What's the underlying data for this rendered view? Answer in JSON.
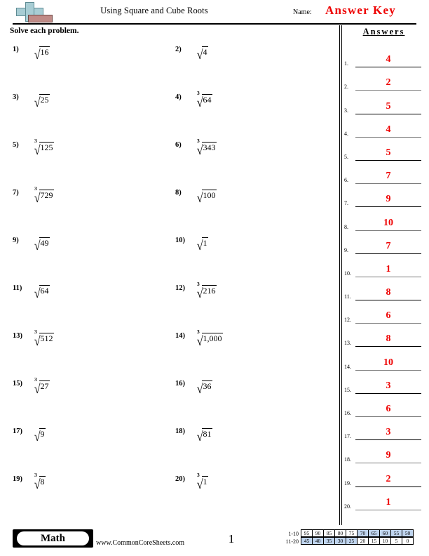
{
  "header": {
    "title": "Using Square and Cube Roots",
    "name_label": "Name:",
    "answer_key": "Answer Key",
    "logo_icon": "plus-block-logo"
  },
  "instruction": "Solve each problem.",
  "problems": [
    {
      "number": "1)",
      "index": "",
      "radicand": "16",
      "symbol": "√"
    },
    {
      "number": "2)",
      "index": "",
      "radicand": "4",
      "symbol": "√"
    },
    {
      "number": "3)",
      "index": "",
      "radicand": "25",
      "symbol": "√"
    },
    {
      "number": "4)",
      "index": "3",
      "radicand": "64",
      "symbol": "√"
    },
    {
      "number": "5)",
      "index": "3",
      "radicand": "125",
      "symbol": "√"
    },
    {
      "number": "6)",
      "index": "3",
      "radicand": "343",
      "symbol": "√"
    },
    {
      "number": "7)",
      "index": "3",
      "radicand": "729",
      "symbol": "√"
    },
    {
      "number": "8)",
      "index": "",
      "radicand": "100",
      "symbol": "√"
    },
    {
      "number": "9)",
      "index": "",
      "radicand": "49",
      "symbol": "√"
    },
    {
      "number": "10)",
      "index": "",
      "radicand": "1",
      "symbol": "√"
    },
    {
      "number": "11)",
      "index": "",
      "radicand": "64",
      "symbol": "√"
    },
    {
      "number": "12)",
      "index": "3",
      "radicand": "216",
      "symbol": "√"
    },
    {
      "number": "13)",
      "index": "3",
      "radicand": "512",
      "symbol": "√"
    },
    {
      "number": "14)",
      "index": "3",
      "radicand": "1,000",
      "symbol": "√"
    },
    {
      "number": "15)",
      "index": "3",
      "radicand": "27",
      "symbol": "√"
    },
    {
      "number": "16)",
      "index": "",
      "radicand": "36",
      "symbol": "√"
    },
    {
      "number": "17)",
      "index": "",
      "radicand": "9",
      "symbol": "√"
    },
    {
      "number": "18)",
      "index": "",
      "radicand": "81",
      "symbol": "√"
    },
    {
      "number": "19)",
      "index": "3",
      "radicand": "8",
      "symbol": "√"
    },
    {
      "number": "20)",
      "index": "3",
      "radicand": "1",
      "symbol": "√"
    }
  ],
  "answers_panel": {
    "title": "Answers",
    "accent_color": "#ee0000",
    "items": [
      {
        "number": "1.",
        "value": "4"
      },
      {
        "number": "2.",
        "value": "2"
      },
      {
        "number": "3.",
        "value": "5"
      },
      {
        "number": "4.",
        "value": "4"
      },
      {
        "number": "5.",
        "value": "5"
      },
      {
        "number": "6.",
        "value": "7"
      },
      {
        "number": "7.",
        "value": "9"
      },
      {
        "number": "8.",
        "value": "10"
      },
      {
        "number": "9.",
        "value": "7"
      },
      {
        "number": "10.",
        "value": "1"
      },
      {
        "number": "11.",
        "value": "8"
      },
      {
        "number": "12.",
        "value": "6"
      },
      {
        "number": "13.",
        "value": "8"
      },
      {
        "number": "14.",
        "value": "10"
      },
      {
        "number": "15.",
        "value": "3"
      },
      {
        "number": "16.",
        "value": "6"
      },
      {
        "number": "17.",
        "value": "3"
      },
      {
        "number": "18.",
        "value": "9"
      },
      {
        "number": "19.",
        "value": "2"
      },
      {
        "number": "20.",
        "value": "1"
      }
    ]
  },
  "footer": {
    "subject_badge": "Math",
    "site_url": "www.CommonCoreSheets.com",
    "page_number": "1",
    "score_grid": {
      "shade_color": "#bfd4ee",
      "rows": [
        {
          "label": "1-10",
          "cells": [
            {
              "value": "95",
              "shaded": false
            },
            {
              "value": "90",
              "shaded": false
            },
            {
              "value": "85",
              "shaded": false
            },
            {
              "value": "80",
              "shaded": false
            },
            {
              "value": "75",
              "shaded": false
            },
            {
              "value": "70",
              "shaded": true
            },
            {
              "value": "65",
              "shaded": true
            },
            {
              "value": "60",
              "shaded": true
            },
            {
              "value": "55",
              "shaded": true
            },
            {
              "value": "50",
              "shaded": true
            }
          ]
        },
        {
          "label": "11-20",
          "cells": [
            {
              "value": "45",
              "shaded": true
            },
            {
              "value": "40",
              "shaded": true
            },
            {
              "value": "35",
              "shaded": true
            },
            {
              "value": "30",
              "shaded": true
            },
            {
              "value": "25",
              "shaded": true
            },
            {
              "value": "20",
              "shaded": false
            },
            {
              "value": "15",
              "shaded": false
            },
            {
              "value": "10",
              "shaded": false
            },
            {
              "value": "5",
              "shaded": false
            },
            {
              "value": "0",
              "shaded": false
            }
          ]
        }
      ]
    }
  }
}
